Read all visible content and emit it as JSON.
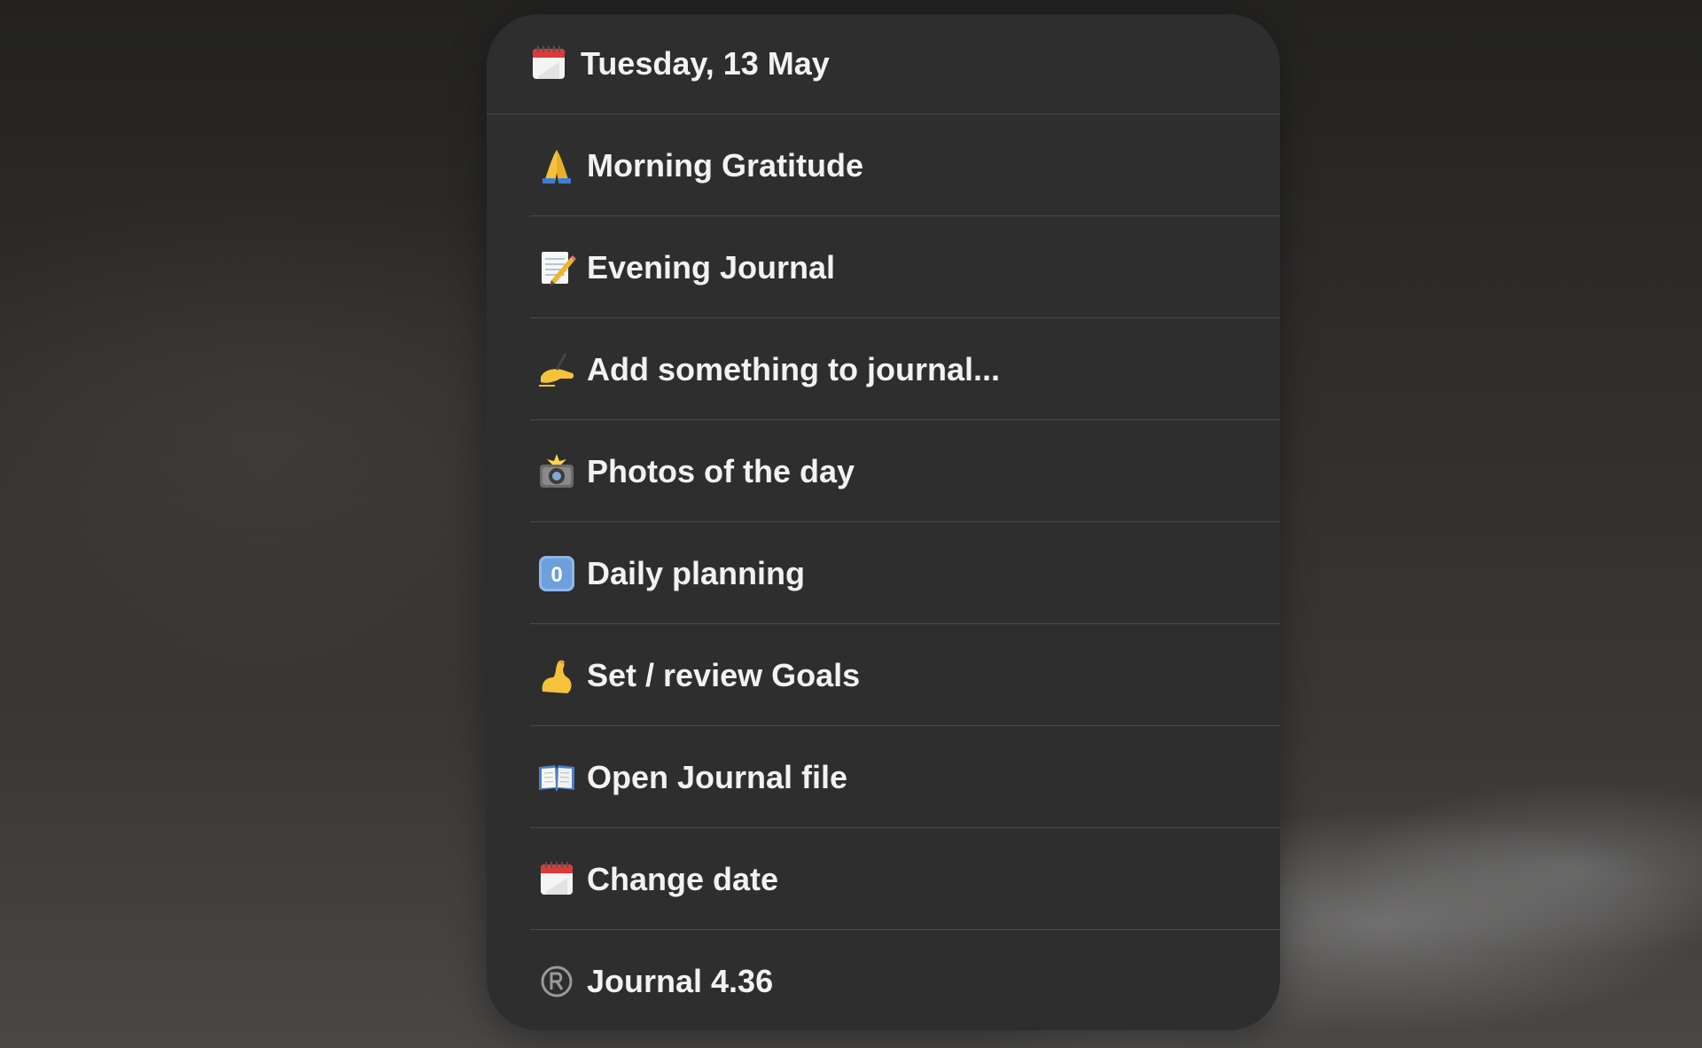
{
  "header": {
    "date_label": "Tuesday, 13 May",
    "icon": "calendar-icon"
  },
  "menu": {
    "items": [
      {
        "label": "Morning Gratitude",
        "icon": "folded-hands-icon"
      },
      {
        "label": "Evening Journal",
        "icon": "memo-icon"
      },
      {
        "label": "Add something to journal...",
        "icon": "writing-hand-icon"
      },
      {
        "label": "Photos of the day",
        "icon": "camera-flash-icon"
      },
      {
        "label": "Daily planning",
        "icon": "keycap-zero-icon"
      },
      {
        "label": "Set / review Goals",
        "icon": "flexed-biceps-icon"
      },
      {
        "label": "Open Journal file",
        "icon": "open-book-icon"
      },
      {
        "label": "Change date",
        "icon": "calendar-icon"
      },
      {
        "label": "Journal 4.36",
        "icon": "registered-icon"
      }
    ]
  },
  "keycap_digit": "0",
  "colors": {
    "menu_bg": "#2e2e2e",
    "separator": "#4a4a4a",
    "text": "#f2f2f2"
  }
}
